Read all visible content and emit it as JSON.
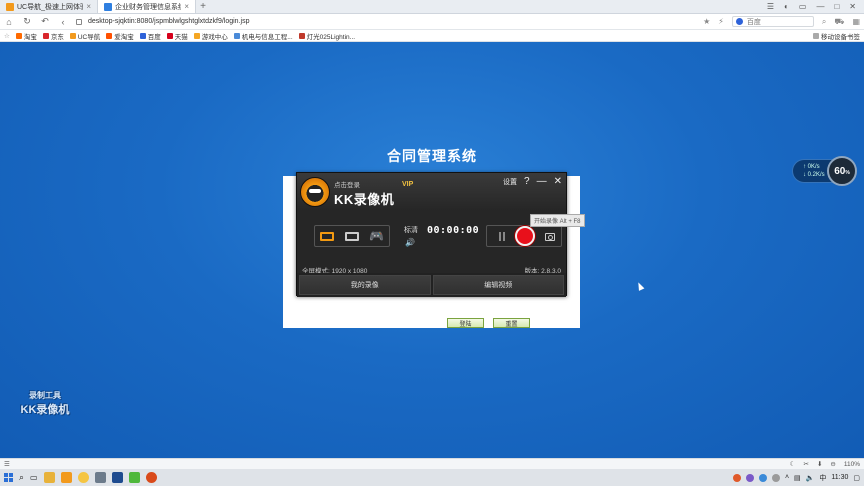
{
  "browser": {
    "tabs": [
      {
        "label": "UC导航_极速上网体验",
        "active": false,
        "color": "#f29a1d"
      },
      {
        "label": "企业财务管理信息系统",
        "active": true,
        "color": "#2f7fe0"
      }
    ],
    "new_tab": "+",
    "window_controls": [
      "☰",
      "◐",
      "▭",
      "—",
      "□",
      "✕"
    ],
    "url": "desktop-sjqktin:8080/jspmblwlgshtglxtdzkf9/login.jsp",
    "search_placeholder": "百度",
    "bookmarks": [
      {
        "label": "淘宝",
        "color": "#ff6a00"
      },
      {
        "label": "京东",
        "color": "#d9262c"
      },
      {
        "label": "UC导航",
        "color": "#f29a1d"
      },
      {
        "label": "爱淘宝",
        "color": "#ff5000"
      },
      {
        "label": "百度",
        "color": "#2e62d9"
      },
      {
        "label": "天猫",
        "color": "#d6001c"
      },
      {
        "label": "游戏中心",
        "color": "#f5a623"
      },
      {
        "label": "机电与信息工程...",
        "color": "#4a8ad8"
      },
      {
        "label": "灯光025Lightin...",
        "color": "#c0392b"
      }
    ],
    "bookmark_right": "移动设备书签"
  },
  "page": {
    "title": "合同管理系统",
    "login_label": "登陆",
    "reset_label": "重置",
    "watermark_line1": "录制工具",
    "watermark_line2": "KK录像机"
  },
  "speed_widget": {
    "up": "0K/s",
    "down": "0.2K/s",
    "percent": "60",
    "unit": "%"
  },
  "kk": {
    "login_text": "点击登录",
    "app_name": "KK录像机",
    "vip": "VIP",
    "settings": "设置",
    "help": "?",
    "minimize": "—",
    "close": "✕",
    "quality": "标清",
    "timer": "00:00:00",
    "tooltip": "开始录像 Alt + F8",
    "resolution": "全屏模式: 1920 x 1080",
    "version": "版本: 2.8.3.0",
    "my_recordings": "我的录像",
    "edit_video": "编辑视频"
  },
  "statusbar": {
    "zoom": "110%"
  },
  "taskbar": {
    "time": "11:30"
  }
}
